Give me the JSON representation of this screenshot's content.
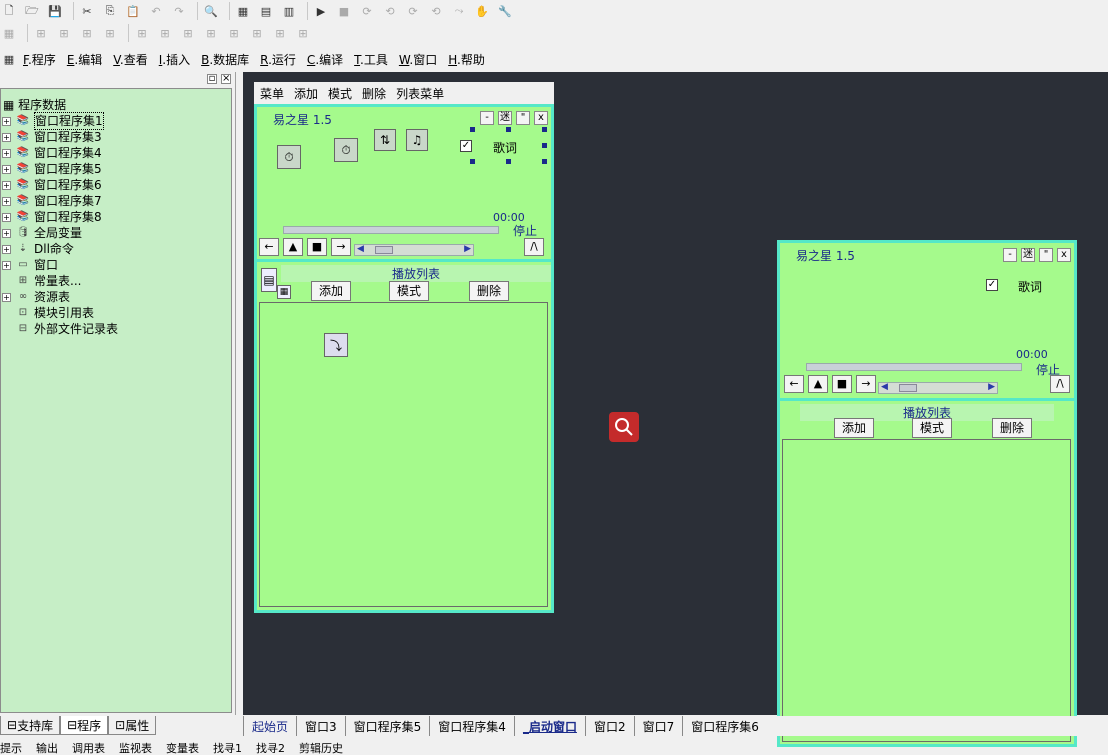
{
  "toolbar": {
    "row1": [
      "new-file-icon",
      "open-folder-icon",
      "save-icon",
      "cut-icon",
      "copy-icon",
      "paste-icon",
      "undo-icon",
      "redo-icon",
      "find-icon",
      "layout1-icon",
      "layout2-icon",
      "layout3-icon",
      "run-icon",
      "stop-icon",
      "step1-icon",
      "step2-icon",
      "step3-icon",
      "step4-icon",
      "step5-icon",
      "hand-icon",
      "debug-icon"
    ],
    "row2": [
      "form-icon",
      "align1-icon",
      "align2-icon",
      "align3-icon",
      "align4-icon",
      "align5-icon",
      "align6-icon",
      "align7-icon",
      "align8-icon",
      "align9-icon",
      "align10-icon",
      "align11-icon",
      "align12-icon"
    ]
  },
  "menubar": {
    "items": [
      {
        "key": "F",
        "label": ".程序"
      },
      {
        "key": "E",
        "label": ".编辑"
      },
      {
        "key": "V",
        "label": ".查看"
      },
      {
        "key": "I",
        "label": ".插入"
      },
      {
        "key": "B",
        "label": ".数据库"
      },
      {
        "key": "R",
        "label": ".运行"
      },
      {
        "key": "C",
        "label": ".编译"
      },
      {
        "key": "T",
        "label": ".工具"
      },
      {
        "key": "W",
        "label": ".窗口"
      },
      {
        "key": "H",
        "label": ".帮助"
      }
    ]
  },
  "tree": {
    "root": "程序数据",
    "items": [
      {
        "label": "窗口程序集1",
        "expand": true,
        "selected": true
      },
      {
        "label": "窗口程序集3",
        "expand": true
      },
      {
        "label": "窗口程序集4",
        "expand": true
      },
      {
        "label": "窗口程序集5",
        "expand": true
      },
      {
        "label": "窗口程序集6",
        "expand": true
      },
      {
        "label": "窗口程序集7",
        "expand": true
      },
      {
        "label": "窗口程序集8",
        "expand": true
      },
      {
        "label": "全局变量",
        "expand": true
      },
      {
        "label": "Dll命令",
        "expand": true
      },
      {
        "label": "窗口",
        "expand": true
      },
      {
        "label": "常量表...",
        "expand": false
      },
      {
        "label": "资源表",
        "expand": true
      },
      {
        "label": "模块引用表",
        "expand": false
      },
      {
        "label": "外部文件记录表",
        "expand": false
      }
    ]
  },
  "left_tabs": [
    "支持库",
    "程序",
    "属性"
  ],
  "window1": {
    "menu": [
      "菜单",
      "添加",
      "模式",
      "删除",
      "列表菜单"
    ],
    "title": "易之星 1.5",
    "sys_buttons": [
      "-",
      "迷",
      "\"",
      "x"
    ],
    "lyrics_label": "歌词",
    "time": "00:00",
    "status": "停止",
    "controls": [
      "←",
      "▲",
      "■",
      "→"
    ],
    "up_button": "/\\",
    "playlist_title": "播放列表",
    "add": "添加",
    "mode": "模式",
    "delete": "删除"
  },
  "window2": {
    "title": "易之星 1.5",
    "sys_buttons": [
      "-",
      "迷",
      "\"",
      "x"
    ],
    "lyrics_label": "歌词",
    "time": "00:00",
    "status": "停止",
    "controls": [
      "←",
      "▲",
      "■",
      "→"
    ],
    "up_button": "/\\",
    "playlist_title": "播放列表",
    "add": "添加",
    "mode": "模式",
    "delete": "删除"
  },
  "doc_tabs": [
    {
      "label": "起始页",
      "active": false
    },
    {
      "label": "窗口3",
      "active": false
    },
    {
      "label": "窗口程序集5",
      "active": false
    },
    {
      "label": "窗口程序集4",
      "active": false
    },
    {
      "label": "_启动窗口",
      "active": true
    },
    {
      "label": "窗口2",
      "active": false
    },
    {
      "label": "窗口7",
      "active": false
    },
    {
      "label": "窗口程序集6",
      "active": false
    }
  ],
  "statusbar": [
    "提示",
    "输出",
    "调用表",
    "监视表",
    "变量表",
    "找寻1",
    "找寻2",
    "剪辑历史"
  ],
  "colors": {
    "form_bg": "#a5fa8c",
    "form_border": "#55e8c8",
    "workspace_bg": "#2b2f37",
    "tree_bg": "#c6eec6",
    "zoom_bg": "#c42b2b"
  }
}
